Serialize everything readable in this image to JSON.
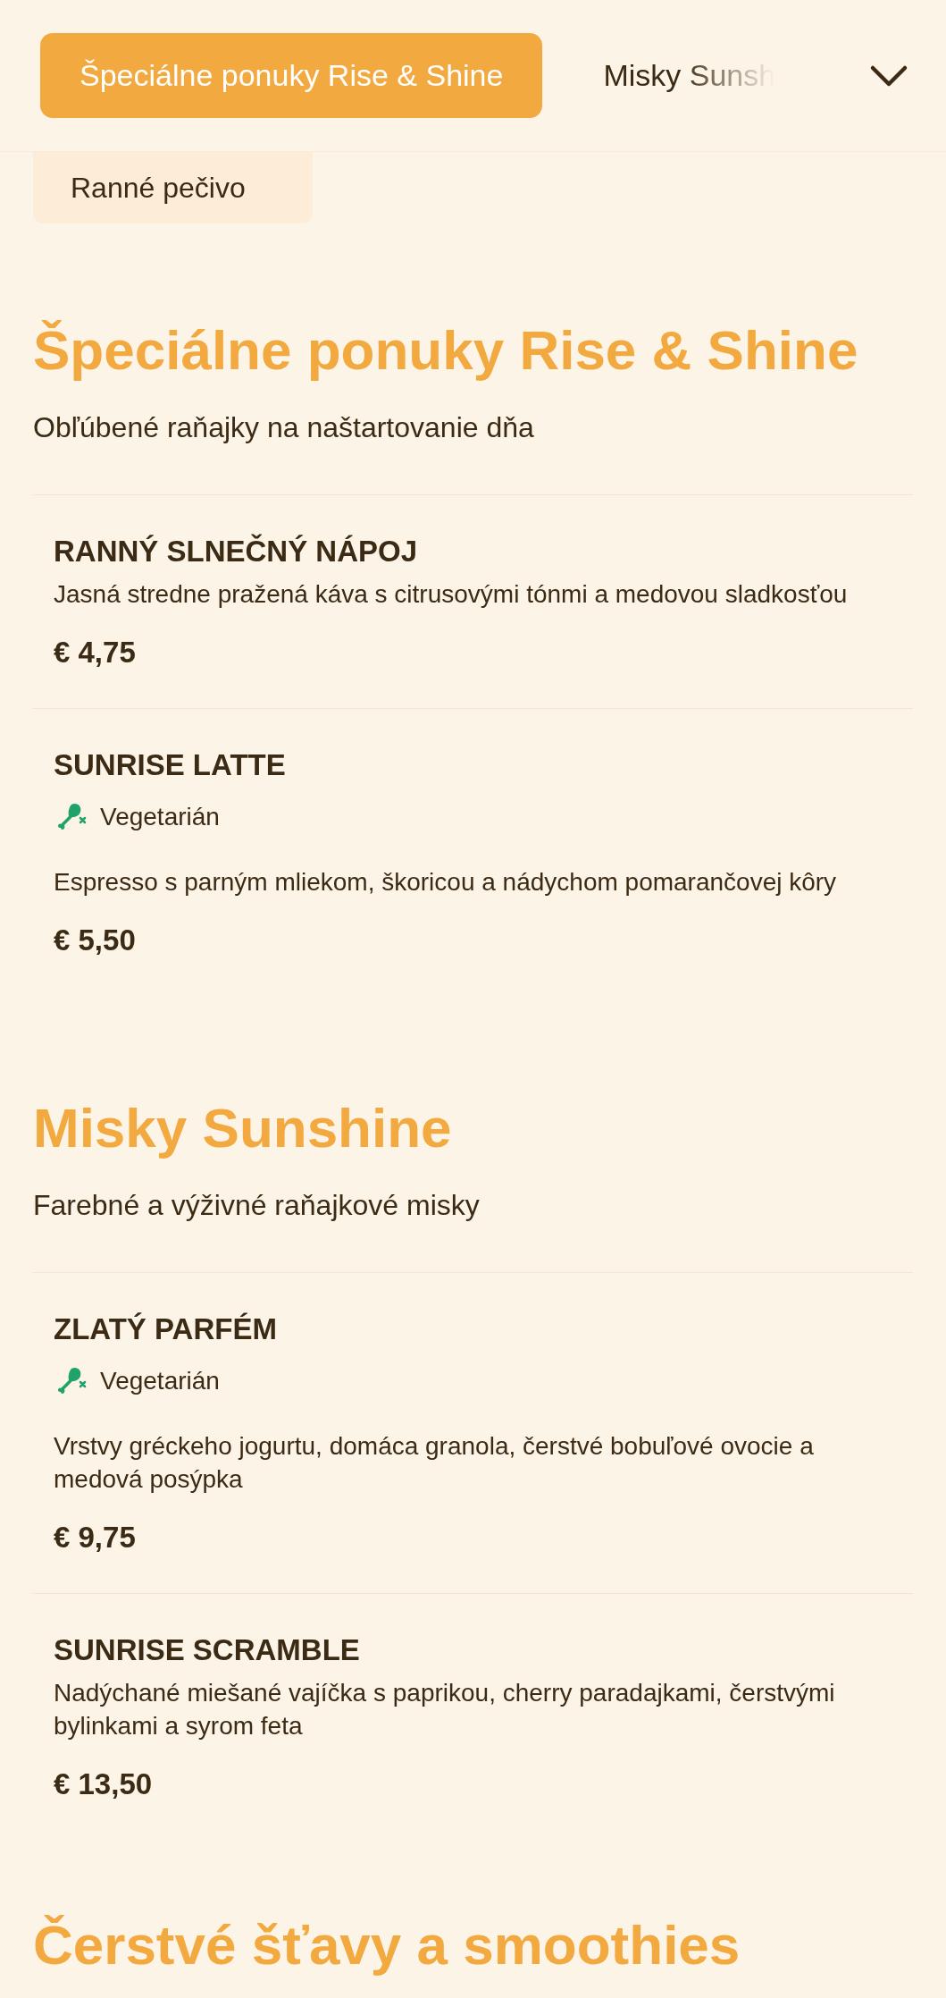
{
  "tabs": [
    {
      "label": "Špeciálne ponuky Rise & Shine",
      "selected": true
    },
    {
      "label": "Misky Sunsh",
      "selected": false
    }
  ],
  "category_menu": {
    "expanded": true,
    "items": [
      {
        "label": "Ranné pečivo"
      }
    ]
  },
  "sections": [
    {
      "title": "Špeciálne ponuky Rise & Shine",
      "subtitle": "Obľúbené raňajky na naštartovanie dňa",
      "items": [
        {
          "name": "RANNÝ SLNEČNÝ NÁPOJ",
          "description": "Jasná stredne pražená káva s citrusovými tónmi a medovou sladkosťou",
          "price": "€ 4,75"
        },
        {
          "name": "SUNRISE LATTE",
          "tags": [
            {
              "kind": "vegetarian",
              "label": "Vegetarián"
            }
          ],
          "description": "Espresso s parným mliekom, škoricou a nádychom pomarančovej kôry",
          "price": "€ 5,50"
        }
      ]
    },
    {
      "title": "Misky Sunshine",
      "subtitle": "Farebné a výživné raňajkové misky",
      "items": [
        {
          "name": "ZLATÝ PARFÉM",
          "tags": [
            {
              "kind": "vegetarian",
              "label": "Vegetarián"
            }
          ],
          "description": "Vrstvy gréckeho jogurtu, domáca granola, čerstvé bobuľové ovocie a medová posýpka",
          "price": "€ 9,75"
        },
        {
          "name": "SUNRISE SCRAMBLE",
          "description": "Nadýchané miešané vajíčka s paprikou, cherry paradajkami, čerstvými bylinkami a syrom feta",
          "price": "€ 13,50"
        }
      ]
    },
    {
      "title": "Čerstvé šťavy a smoothies"
    }
  ]
}
